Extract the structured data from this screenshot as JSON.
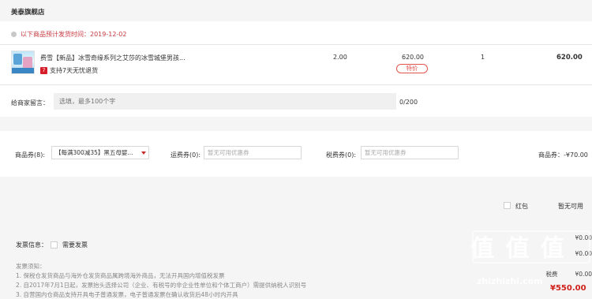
{
  "store": {
    "name": "美泰旗舰店"
  },
  "shipping": {
    "notice": "以下商品预计发货时间：2019-12-02"
  },
  "product": {
    "title": "费雪【新品】冰雪奇缘系列之艾莎的冰雪城堡男孩...",
    "return_badge": "7",
    "return_text": "支持7天无忧退货",
    "unit_tax": "2.00",
    "unit_price": "620.00",
    "price_tag": "特价",
    "quantity": "1",
    "subtotal": "620.00"
  },
  "message": {
    "label": "给商家留言：",
    "placeholder": "选填，最多100个字",
    "count": "0/200"
  },
  "coupons": {
    "goods_label": "商品券(8):",
    "goods_value": "【每满300减35】黑五母婴...",
    "shipping_label": "运费券(0):",
    "shipping_value": "暂无可用优惠券",
    "tax_label": "税费券(0):",
    "tax_value": "暂无可用优惠券",
    "goods_amount": "商品券：-¥70.00"
  },
  "redpack": {
    "label": "红包",
    "status": "暂无可用"
  },
  "invoice": {
    "label": "发票信息：",
    "option": "需要发票",
    "notes": [
      "发票须知：",
      "1. 保税仓发货商品与海外仓发货商品属跨境海外商品，无法开具国内增值税发票",
      "2. 自2017年7月1日起，发票抬头选择公司（企业、有税号的非企业性单位和个体工商户）需提供纳税人识别号",
      "3. 自营国内仓商品支持开具电子普通发票，电子普通发票在确认收货后48小时内开具"
    ]
  },
  "summary": {
    "line1": "¥0.00",
    "line2": "¥0.00",
    "tax_label": "税费",
    "tax_value": "¥0.00",
    "total": "¥550.00"
  },
  "watermark": {
    "big": "值 值 值",
    "site": "zhizhizhi.com"
  }
}
